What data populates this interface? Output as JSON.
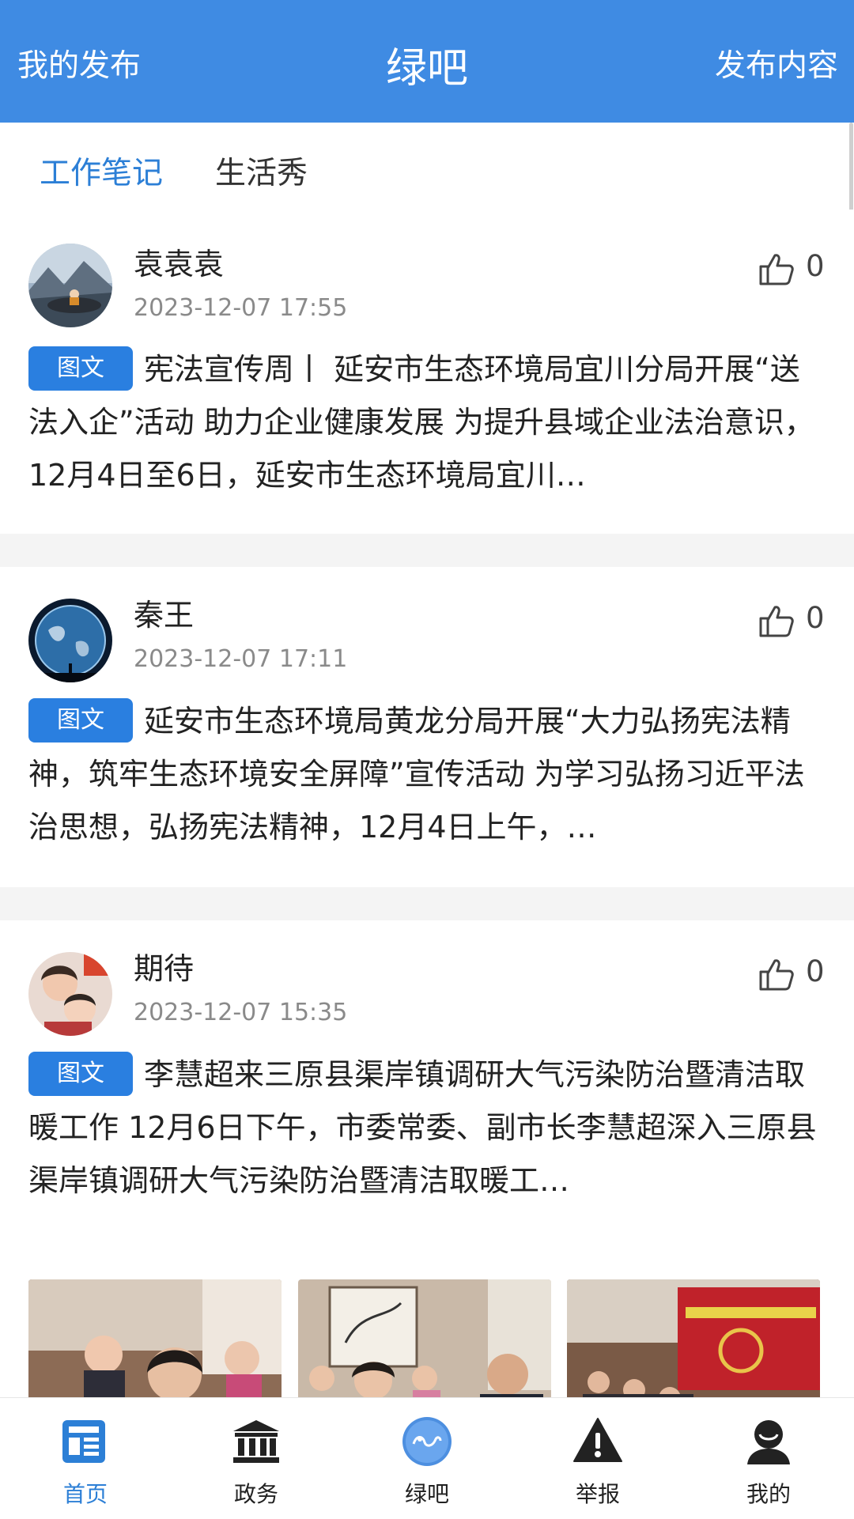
{
  "header": {
    "left_label": "我的发布",
    "title": "绿吧",
    "right_label": "发布内容",
    "bg_color": "#3f8be3"
  },
  "tabs": [
    {
      "label": "工作笔记",
      "active": true
    },
    {
      "label": "生活秀",
      "active": false
    }
  ],
  "posts": [
    {
      "author": "袁袁袁",
      "time": "2023-12-07 17:55",
      "likes": "0",
      "badge": "图文",
      "text": "宪法宣传周丨 延安市生态环境局宜川分局开展“送法入企”活动 助力企业健康发展 为提升县域企业法治意识，12月4日至6日，延安市生态环境局宜川…"
    },
    {
      "author": "秦王",
      "time": "2023-12-07 17:11",
      "likes": "0",
      "badge": "图文",
      "text": "延安市生态环境局黄龙分局开展“大力弘扬宪法精神，筑牢生态环境安全屏障”宣传活动 为学习弘扬习近平法治思想，弘扬宪法精神，12月4日上午，…"
    },
    {
      "author": "期待",
      "time": "2023-12-07 15:35",
      "likes": "0",
      "badge": "图文",
      "text": "李慧超来三原县渠岸镇调研大气污染防治暨清洁取暖工作 12月6日下午，市委常委、副市长李慧超深入三原县渠岸镇调研大气污染防治暨清洁取暖工…"
    }
  ],
  "bottom_nav": [
    {
      "label": "首页",
      "icon": "news-icon",
      "active": true
    },
    {
      "label": "政务",
      "icon": "government-building-icon",
      "active": false
    },
    {
      "label": "绿吧",
      "icon": "lvba-logo-icon",
      "active": false
    },
    {
      "label": "举报",
      "icon": "warning-icon",
      "active": false
    },
    {
      "label": "我的",
      "icon": "user-icon",
      "active": false
    }
  ],
  "colors": {
    "accent": "#2c7fd6",
    "badge": "#2a7fe0",
    "separator": "#f4f4f4"
  }
}
